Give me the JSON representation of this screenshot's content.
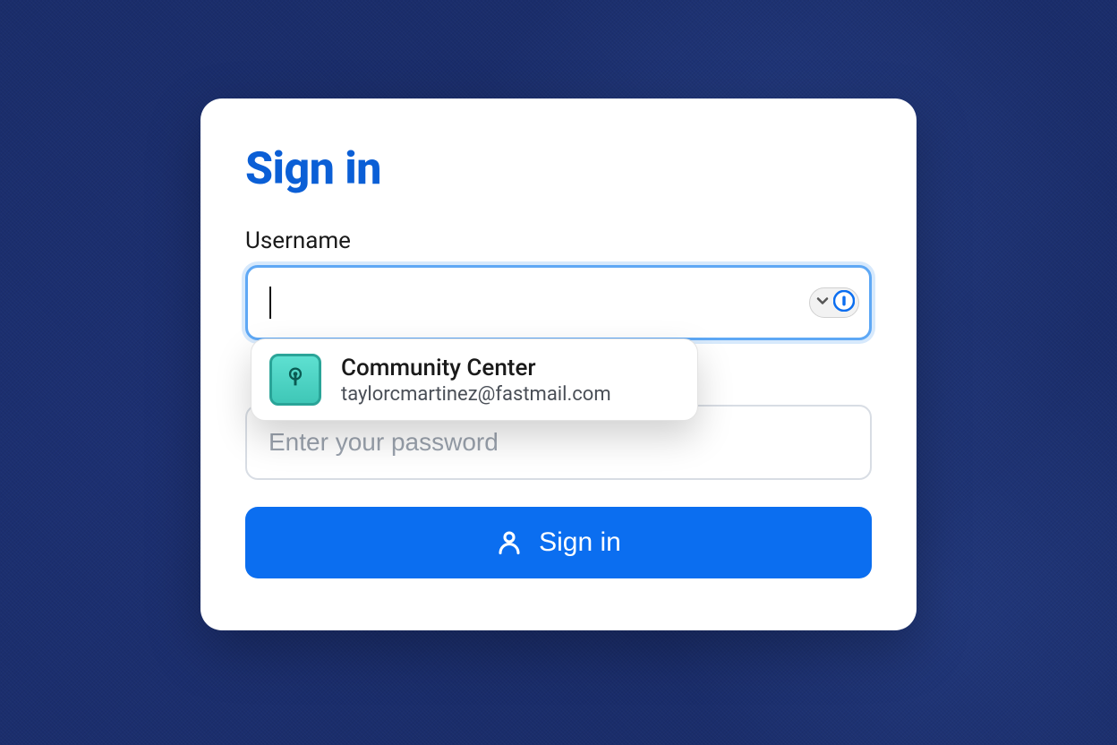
{
  "form": {
    "title": "Sign in",
    "username_label": "Username",
    "username_value": "",
    "password_placeholder": "Enter your password",
    "submit_label": "Sign in"
  },
  "autofill": {
    "site_name": "Community Center",
    "username": "taylorcmartinez@fastmail.com"
  }
}
